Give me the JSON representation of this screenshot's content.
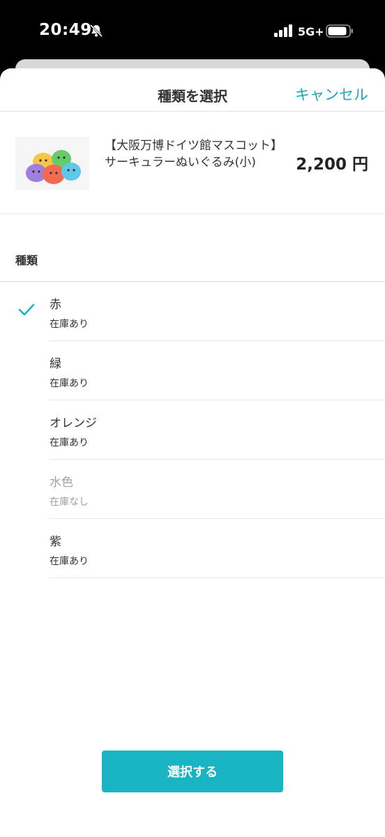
{
  "status_bar": {
    "time": "20:49",
    "network": "5G+",
    "icons": [
      "bell-slash-icon",
      "signal-icon",
      "battery-icon"
    ]
  },
  "header": {
    "title": "種類を選択",
    "cancel_label": "キャンセル"
  },
  "product": {
    "name": "【大阪万博ドイツ館マスコット】サーキュラーぬいぐるみ(小)",
    "price": "2,200 円"
  },
  "variant_section": {
    "label": "種類",
    "selected_index": 0,
    "options": [
      {
        "name": "赤",
        "stock": "在庫あり",
        "available": true
      },
      {
        "name": "緑",
        "stock": "在庫あり",
        "available": true
      },
      {
        "name": "オレンジ",
        "stock": "在庫あり",
        "available": true
      },
      {
        "name": "水色",
        "stock": "在庫なし",
        "available": false
      },
      {
        "name": "紫",
        "stock": "在庫あり",
        "available": true
      }
    ]
  },
  "footer": {
    "select_label": "選択する"
  },
  "colors": {
    "accent": "#18b4c3",
    "link": "#1aa6b8",
    "disabled_text": "#a0a0a0"
  }
}
